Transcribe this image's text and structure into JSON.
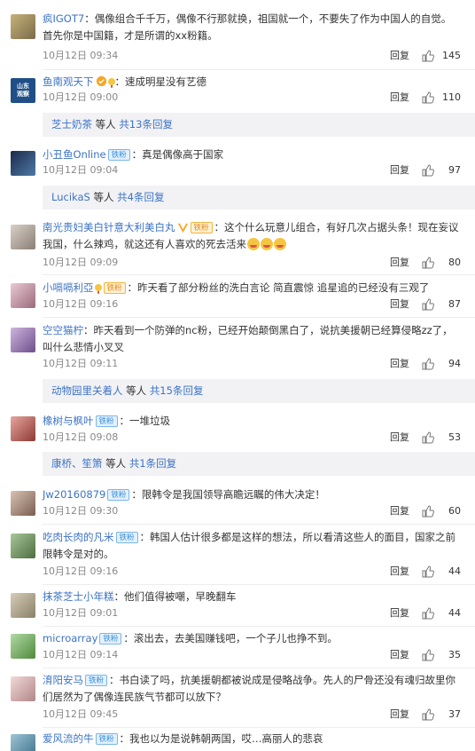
{
  "colors": {
    "link": "#3c73c5",
    "meta": "#888888",
    "sub_bg": "#f2f2f5"
  },
  "comments": [
    {
      "name": "疯IGOT7",
      "badge": "",
      "text": "：偶像组合千千万，偶像不行那就换，祖国就一个，不要失了作为中国人的自觉。首先你是中国籍，才是所谓的xx粉籍。",
      "time": "10月12日 09:34",
      "reply": "回复",
      "likes": "145"
    },
    {
      "name": "鱼南观天下",
      "badge": "",
      "text": "：速成明星没有艺德",
      "time": "10月12日 09:00",
      "reply": "回复",
      "likes": "110",
      "avatar_text": "山东\n观察"
    },
    {
      "name": "小丑鱼Online",
      "badge": "铁粉",
      "text": "：真是偶像高于国家",
      "time": "10月12日 09:04",
      "reply": "回复",
      "likes": "97"
    },
    {
      "name": "南光贵妇美白针意大利美白丸",
      "badge": "铁粉",
      "text": "：这个什么玩意儿组合，有好几次占据头条！现在妄议我国，什么辣鸡，就这还有人喜欢的死去活来",
      "time": "10月12日 09:09",
      "reply": "回复",
      "likes": "80"
    },
    {
      "name": "小嗝嗝利亞",
      "badge": "铁粉",
      "text": "：昨天看了部分粉丝的洗白言论 简直震惊 追星追的已经没有三观了",
      "time": "10月12日 09:16",
      "reply": "回复",
      "likes": "87"
    },
    {
      "name": "空空猫柠",
      "badge": "",
      "text": "：昨天看到一个防弹的nc粉，已经开始颠倒黑白了，说抗美援朝已经算侵略zz了，叫什么悲情小叉叉",
      "time": "10月12日 09:11",
      "reply": "回复",
      "likes": "94"
    },
    {
      "name": "橡树与枫叶",
      "badge": "铁粉",
      "text": "：一堆垃圾",
      "time": "10月12日 09:08",
      "reply": "回复",
      "likes": "53"
    },
    {
      "name": "Jw20160879",
      "badge": "铁粉",
      "text": "：限韩令是我国领导高瞻远瞩的伟大决定！",
      "time": "10月12日 09:30",
      "reply": "回复",
      "likes": "60"
    },
    {
      "name": "吃肉长肉的凡米",
      "badge": "铁粉",
      "text": "：韩国人估计很多都是这样的想法，所以看清这些人的面目，国家之前限韩令是对的。",
      "time": "10月12日 09:16",
      "reply": "回复",
      "likes": "44"
    },
    {
      "name": "抹茶芝士小年糕",
      "badge": "",
      "text": "：他们值得被嘲，早晚翻车",
      "time": "10月12日 09:01",
      "reply": "回复",
      "likes": "44"
    },
    {
      "name": "microarray",
      "badge": "铁粉",
      "text": "：滚出去，去美国赚钱吧，一个子儿也挣不到。",
      "time": "10月12日 09:14",
      "reply": "回复",
      "likes": "35"
    },
    {
      "name": "淯阳安马",
      "badge": "铁粉",
      "text": "：书白读了吗，抗美援朝都被说成是侵略战争。先人的尸骨还没有魂归故里你们居然为了偶像连民族气节都可以放下？",
      "time": "10月12日 09:45",
      "reply": "回复",
      "likes": "37"
    },
    {
      "name": "爱风流的牛",
      "badge": "铁粉",
      "text": "：我也以为是说韩朝两国，哎…高丽人的悲哀",
      "time": "",
      "reply": "",
      "likes": ""
    }
  ],
  "subs": [
    {
      "names": "芝士奶茶",
      "middle": " 等人 ",
      "total": "共13条回复"
    },
    {
      "names": "LucikaS",
      "middle": " 等人 ",
      "total": "共4条回复"
    },
    {
      "names": "动物园里关着人",
      "middle": " 等人 ",
      "total": "共15条回复"
    },
    {
      "names": "康桥、笙箫",
      "middle": " 等人 ",
      "total": "共1条回复"
    }
  ],
  "badges": {
    "iron": "铁粉",
    "gold": "铁粉"
  }
}
